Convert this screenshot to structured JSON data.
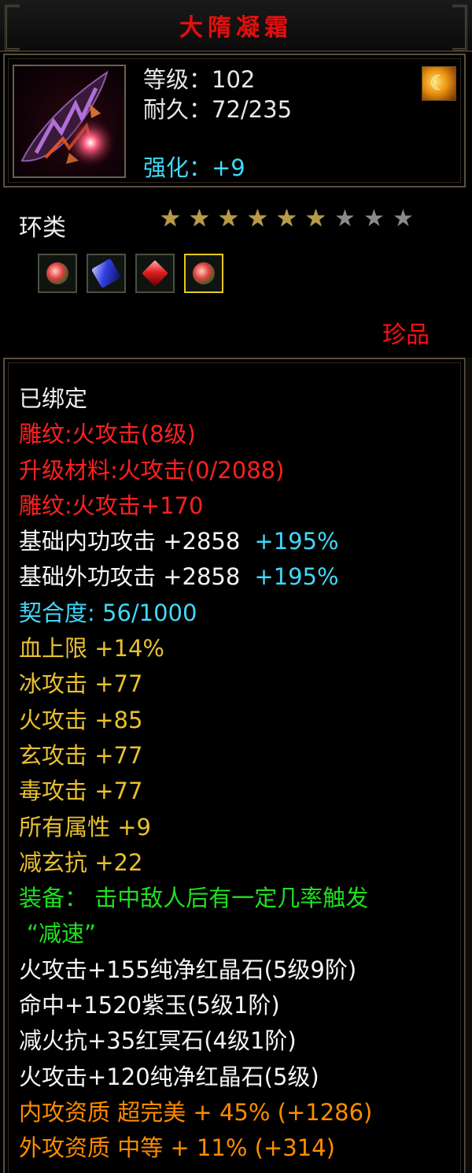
{
  "window": {
    "title": "大隋凝霜"
  },
  "header": {
    "level": "等级：102",
    "durability": "耐久：72/235",
    "enhance": "强化：+9"
  },
  "item": {
    "type": "环类",
    "stars_filled": 6,
    "stars_total": 9,
    "gem_slots": [
      {
        "kind": "red-green",
        "selected": false
      },
      {
        "kind": "blue",
        "selected": false
      },
      {
        "kind": "red",
        "selected": false
      },
      {
        "kind": "red-green",
        "selected": true
      }
    ],
    "rarity": "珍品"
  },
  "attributes": {
    "bound": "已绑定",
    "engrave1": "雕纹:火攻击(8级)",
    "upgrade": "升级材料:火攻击(0/2088)",
    "engrave2": "雕纹:火攻击+170",
    "inner_atk": "基础内功攻击 +2858",
    "inner_atk_pct": "+195%",
    "outer_atk": "基础外功攻击 +2858",
    "outer_atk_pct": "+195%",
    "fit": "契合度: 56/1000",
    "hp": "血上限 +14%",
    "ice": "冰攻击 +77",
    "fire": "火攻击 +85",
    "xuan": "玄攻击 +77",
    "poison": "毒攻击 +77",
    "all": "所有属性 +9",
    "xuan_res": "减玄抗 +22",
    "equip1": "装备： 击中敌人后有一定几率触发",
    "equip2": "“减速”",
    "gem1": "火攻击+155纯净红晶石(5级9阶)",
    "gem2": "命中+1520紫玉(5级1阶)",
    "gem3": "减火抗+35红冥石(4级1阶)",
    "gem4": "火攻击+120纯净红晶石(5级)",
    "q_inner": "内攻资质 超完美 + 45% (+1286)",
    "q_outer": "外攻资质 中等 + 11% (+314)"
  },
  "colors": {
    "title": "#e01010",
    "cyan": "#40d8f8",
    "red": "#ff2020",
    "gold": "#e8c030",
    "green": "#20e020",
    "orange": "#ff8c00",
    "border": "#5a5040"
  },
  "icons": {
    "item": "weapon-ring-icon",
    "badge": "golden-flame-icon",
    "star": "star-icon"
  }
}
